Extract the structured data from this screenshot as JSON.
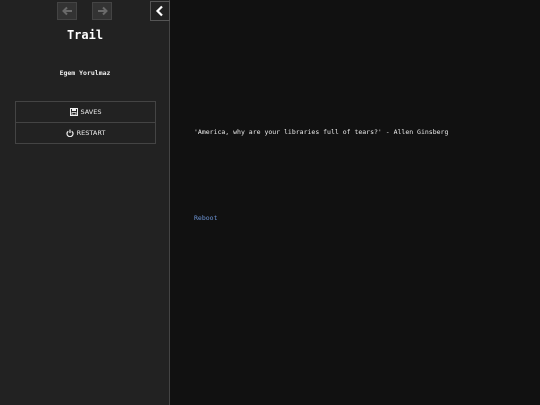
{
  "sidebar": {
    "title": "Trail",
    "author": "Egem Yorulmaz",
    "menu": {
      "saves_label": "SAVES",
      "restart_label": "RESTART"
    },
    "icons": {
      "back": "arrow-left-icon",
      "forward": "arrow-right-icon",
      "toggle": "chevron-left-icon",
      "saves": "floppy-disk-icon",
      "restart": "power-icon"
    }
  },
  "passage": {
    "quote": "'America, why are your libraries full of tears?' - Allen Ginsberg",
    "link": "Reboot"
  },
  "colors": {
    "page_background": "#111111",
    "sidebar_background": "#222222",
    "text": "#eeeeee",
    "link": "#6d95d6"
  }
}
